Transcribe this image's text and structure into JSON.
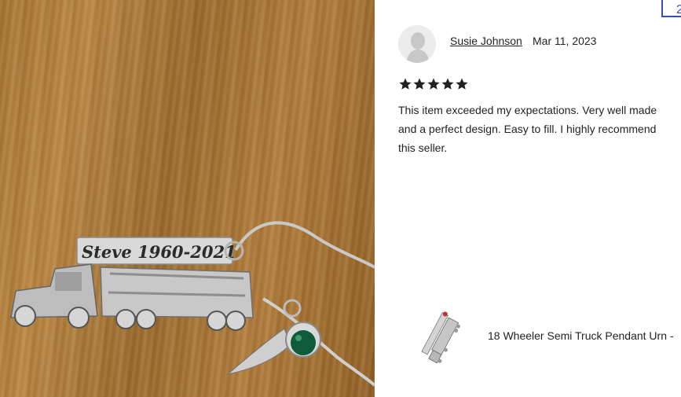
{
  "review": {
    "reviewer_name": "Susie Johnson",
    "date": "Mar 11, 2023",
    "rating": 5,
    "text": "This item exceeded my expectations. Very well made\nand a perfect design. Easy to fill. I highly recommend\nthis seller."
  },
  "photo": {
    "engraving": "Steve 1960-2021"
  },
  "product": {
    "title": "18 Wheeler Semi Truck Pendant Urn -"
  },
  "corner": {
    "digit": "2"
  },
  "colors": {
    "star": "#222222",
    "link_accent": "#3a4fb0"
  },
  "icons": {
    "avatar": "default-user-avatar-icon",
    "star": "star-icon"
  }
}
